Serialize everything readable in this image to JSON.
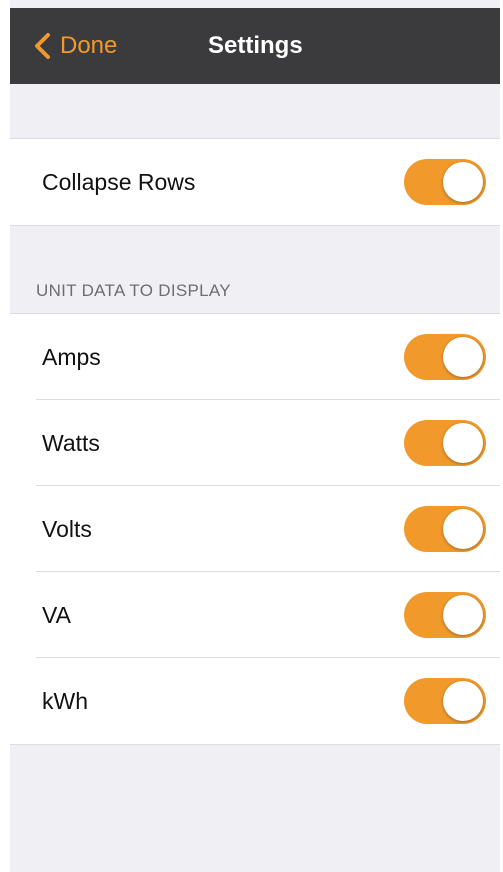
{
  "navbar": {
    "back_label": "Done",
    "title": "Settings",
    "accent_color": "#f19a2b",
    "background_color": "#3b3b3d"
  },
  "collapse_group": {
    "label": "Collapse Rows",
    "enabled": true
  },
  "unit_section": {
    "header": "UNIT DATA TO DISPLAY",
    "items": [
      {
        "label": "Amps",
        "enabled": true
      },
      {
        "label": "Watts",
        "enabled": true
      },
      {
        "label": "Volts",
        "enabled": true
      },
      {
        "label": "VA",
        "enabled": true
      },
      {
        "label": "kWh",
        "enabled": true
      }
    ]
  },
  "icons": {
    "back": "chevron-left-icon"
  }
}
